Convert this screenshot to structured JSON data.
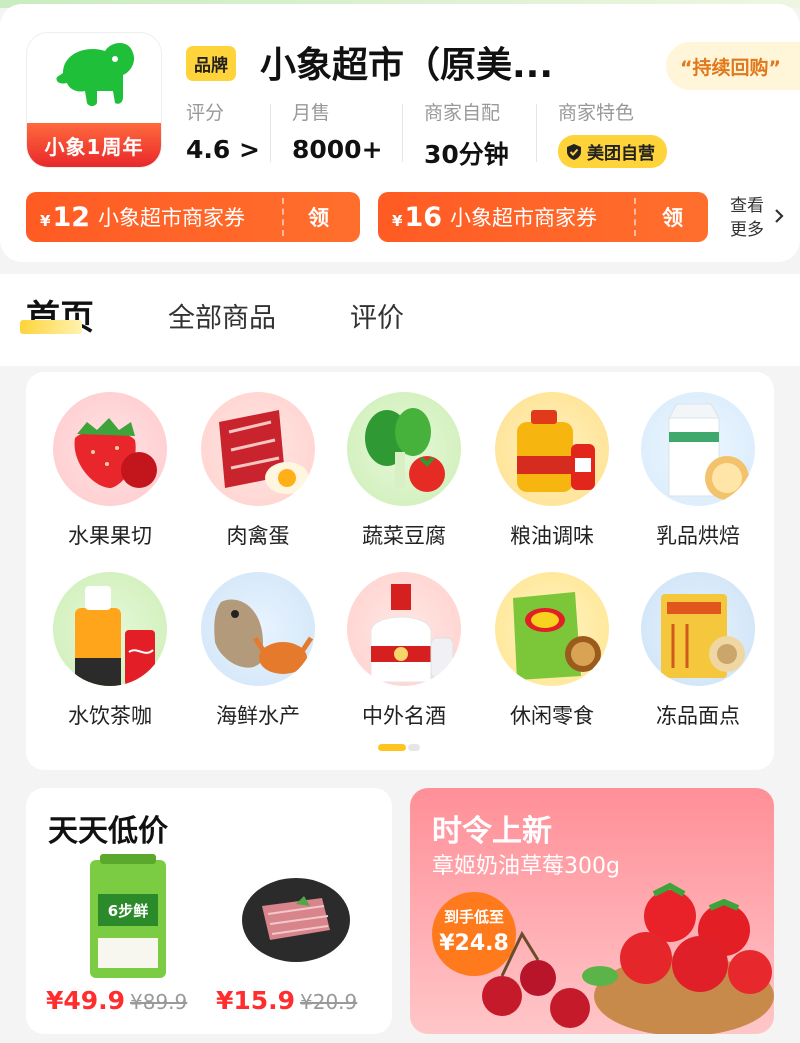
{
  "store": {
    "brand_tag": "品牌",
    "name": "小象超市（原美...",
    "logo_text": "小象1周年",
    "repurchase_tag": "“持续回购”",
    "stats": {
      "rating_label": "评分",
      "rating_value": "4.6 >",
      "sales_label": "月售",
      "sales_value": "8000+",
      "delivery_label": "商家自配",
      "delivery_value": "30分钟",
      "feature_label": "商家特色",
      "feature_value": "美团自营"
    },
    "coupons": [
      {
        "symbol": "¥",
        "amount": "12",
        "name": "小象超市商家券",
        "action": "领"
      },
      {
        "symbol": "¥",
        "amount": "16",
        "name": "小象超市商家券",
        "action": "领"
      }
    ],
    "more_line1": "查看",
    "more_line2": "更多"
  },
  "tabs": [
    {
      "label": "首页",
      "active": true
    },
    {
      "label": "全部商品",
      "active": false
    },
    {
      "label": "评价",
      "active": false
    }
  ],
  "categories": [
    {
      "label": "水果果切",
      "icon": "strawberry-icon"
    },
    {
      "label": "肉禽蛋",
      "icon": "meat-icon"
    },
    {
      "label": "蔬菜豆腐",
      "icon": "vegetable-icon"
    },
    {
      "label": "粮油调味",
      "icon": "oil-icon"
    },
    {
      "label": "乳品烘焙",
      "icon": "milk-icon"
    },
    {
      "label": "水饮茶咖",
      "icon": "drink-icon"
    },
    {
      "label": "海鲜水产",
      "icon": "seafood-icon"
    },
    {
      "label": "中外名酒",
      "icon": "liquor-icon"
    },
    {
      "label": "休闲零食",
      "icon": "snack-icon"
    },
    {
      "label": "冻品面点",
      "icon": "frozen-food-icon"
    }
  ],
  "deals": {
    "title": "天天低价",
    "items": [
      {
        "price": "¥49.9",
        "old_price": "¥89.9",
        "image_text": "6步鲜"
      },
      {
        "price": "¥15.9",
        "old_price": "¥20.9"
      }
    ]
  },
  "new_arrivals": {
    "title": "时令上新",
    "subtitle": "章姬奶油草莓300g",
    "badge_line1": "到手低至",
    "badge_line2": "¥24.8"
  },
  "colors": {
    "accent_yellow": "#ffd43a",
    "coupon_orange": "#ff5b24",
    "price_red": "#ff2d2d",
    "brand_green": "#1fbf3a"
  }
}
